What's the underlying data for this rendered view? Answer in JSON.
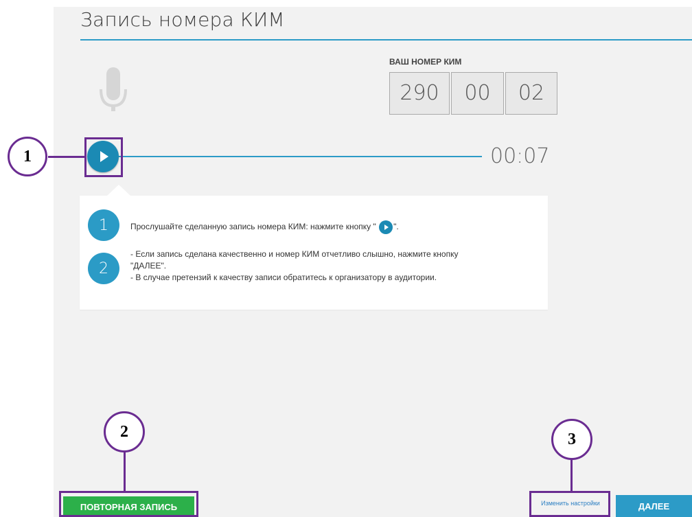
{
  "header": {
    "title": "Запись номера КИМ"
  },
  "kim": {
    "label": "ВАШ НОМЕР КИМ",
    "parts": [
      "290",
      "00",
      "02"
    ]
  },
  "player": {
    "time": "00:07"
  },
  "instructions": {
    "step1": {
      "number": "1",
      "text_before": "Прослушайте сделанную запись номера КИМ: нажмите кнопку \" ",
      "text_after": "\"."
    },
    "step2": {
      "number": "2",
      "line1": "- Если запись сделана качественно и номер КИМ отчетливо слышно, нажмите кнопку",
      "line2": "\"ДАЛЕЕ\".",
      "line3": "- В случае претензий к качеству записи обратитесь к организатору в аудитории."
    }
  },
  "annotations": {
    "a1": "1",
    "a2": "2",
    "a3": "3"
  },
  "footer": {
    "retry_label": "ПОВТОРНАЯ ЗАПИСЬ",
    "settings_label": "Изменить настройки",
    "next_label": "ДАЛЕЕ"
  },
  "colors": {
    "accent": "#2c9bc7",
    "annotation": "#6a2c91",
    "retry": "#2cb04a"
  },
  "icons": {
    "mic": "microphone-icon",
    "play": "play-icon"
  }
}
